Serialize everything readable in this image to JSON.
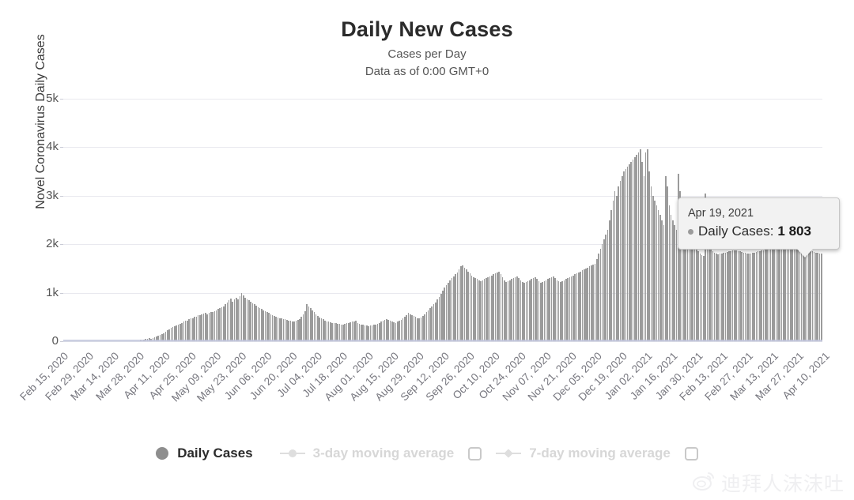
{
  "header": {
    "title": "Daily New Cases",
    "subtitle": "Cases per Day",
    "subtitle2": "Data as of 0:00 GMT+0"
  },
  "y_axis": {
    "title": "Novel Coronavirus Daily Cases",
    "ticks": [
      "5k",
      "4k",
      "3k",
      "2k",
      "1k",
      "0"
    ]
  },
  "tooltip": {
    "date": "Apr 19, 2021",
    "series_label": "Daily Cases:",
    "value": "1 803",
    "dot_color": "#9b9b9b"
  },
  "legend": {
    "items": [
      {
        "label": "Daily Cases",
        "marker": "filled-circle",
        "state": "active",
        "checkbox": false
      },
      {
        "label": "3-day moving average",
        "marker": "line-circle",
        "state": "muted",
        "checkbox": true
      },
      {
        "label": "7-day moving average",
        "marker": "line-diamond",
        "state": "muted",
        "checkbox": true
      }
    ]
  },
  "watermark": {
    "text": "迪拜人沫沫吐",
    "icon": "weibo-icon"
  },
  "colors": {
    "bar": "#9b9b9b",
    "grid": "#e9e9ef",
    "zero_line": "#d8dae6",
    "moving_average_line": "#c3c7dd",
    "tick_text": "#555555",
    "xlabel_text": "#76767e"
  },
  "chart_data": {
    "type": "bar",
    "title": "Daily New Cases",
    "subtitle": "Cases per Day",
    "xlabel": "",
    "ylabel": "Novel Coronavirus Daily Cases",
    "ylim": [
      0,
      5000
    ],
    "yticks": [
      0,
      1000,
      2000,
      3000,
      4000,
      5000
    ],
    "grid": true,
    "legend_position": "bottom",
    "x_tick_labels": [
      "Feb 15, 2020",
      "Feb 29, 2020",
      "Mar 14, 2020",
      "Mar 28, 2020",
      "Apr 11, 2020",
      "Apr 25, 2020",
      "May 09, 2020",
      "May 23, 2020",
      "Jun 06, 2020",
      "Jun 20, 2020",
      "Jul 04, 2020",
      "Jul 18, 2020",
      "Aug 01, 2020",
      "Aug 15, 2020",
      "Aug 29, 2020",
      "Sep 12, 2020",
      "Sep 26, 2020",
      "Oct 10, 2020",
      "Oct 24, 2020",
      "Nov 07, 2020",
      "Nov 21, 2020",
      "Dec 05, 2020",
      "Dec 19, 2020",
      "Jan 02, 2021",
      "Jan 16, 2021",
      "Jan 30, 2021",
      "Feb 13, 2021",
      "Feb 27, 2021",
      "Mar 13, 2021",
      "Mar 27, 2021",
      "Apr 10, 2021"
    ],
    "x_tick_interval_days": 14,
    "start_date": "Feb 15, 2020",
    "end_date": "Apr 19, 2021",
    "highlighted_point": {
      "x": "Apr 19, 2021",
      "y": 1803
    },
    "series": [
      {
        "name": "Daily Cases",
        "values": [
          0,
          0,
          0,
          0,
          0,
          0,
          0,
          0,
          0,
          0,
          0,
          0,
          0,
          0,
          0,
          0,
          0,
          0,
          0,
          0,
          0,
          0,
          0,
          0,
          0,
          0,
          0,
          0,
          0,
          0,
          0,
          0,
          0,
          0,
          0,
          0,
          0,
          0,
          0,
          0,
          0,
          0,
          30,
          35,
          40,
          45,
          50,
          60,
          55,
          70,
          80,
          90,
          110,
          130,
          150,
          170,
          200,
          230,
          250,
          270,
          290,
          310,
          330,
          350,
          360,
          380,
          400,
          420,
          430,
          450,
          470,
          480,
          500,
          510,
          530,
          540,
          560,
          570,
          580,
          560,
          590,
          600,
          610,
          620,
          640,
          660,
          680,
          700,
          720,
          760,
          800,
          850,
          880,
          820,
          860,
          900,
          870,
          930,
          990,
          950,
          900,
          870,
          840,
          810,
          790,
          760,
          730,
          700,
          680,
          660,
          640,
          620,
          600,
          580,
          560,
          540,
          520,
          500,
          490,
          480,
          470,
          460,
          450,
          440,
          430,
          420,
          410,
          400,
          420,
          440,
          460,
          500,
          560,
          620,
          760,
          720,
          680,
          640,
          600,
          560,
          520,
          490,
          470,
          450,
          430,
          410,
          400,
          390,
          380,
          370,
          370,
          360,
          360,
          350,
          350,
          360,
          370,
          380,
          390,
          400,
          410,
          420,
          380,
          360,
          350,
          340,
          330,
          320,
          310,
          320,
          330,
          340,
          350,
          360,
          380,
          400,
          420,
          440,
          460,
          440,
          420,
          400,
          390,
          380,
          400,
          420,
          440,
          470,
          500,
          540,
          580,
          560,
          540,
          520,
          500,
          480,
          470,
          490,
          520,
          560,
          600,
          640,
          680,
          720,
          760,
          800,
          860,
          920,
          980,
          1040,
          1100,
          1150,
          1200,
          1250,
          1300,
          1340,
          1380,
          1420,
          1480,
          1540,
          1560,
          1520,
          1480,
          1440,
          1400,
          1360,
          1320,
          1300,
          1280,
          1260,
          1240,
          1260,
          1280,
          1300,
          1320,
          1340,
          1360,
          1380,
          1400,
          1420,
          1440,
          1380,
          1320,
          1260,
          1220,
          1240,
          1260,
          1280,
          1300,
          1320,
          1340,
          1300,
          1260,
          1220,
          1200,
          1220,
          1240,
          1260,
          1280,
          1300,
          1320,
          1280,
          1240,
          1200,
          1220,
          1240,
          1260,
          1280,
          1300,
          1320,
          1340,
          1300,
          1260,
          1240,
          1220,
          1240,
          1260,
          1280,
          1300,
          1320,
          1340,
          1360,
          1380,
          1400,
          1420,
          1440,
          1460,
          1480,
          1500,
          1520,
          1540,
          1560,
          1580,
          1600,
          1700,
          1800,
          1900,
          2000,
          2100,
          2200,
          2300,
          2500,
          2700,
          2900,
          3100,
          3000,
          3200,
          3300,
          3400,
          3500,
          3550,
          3600,
          3650,
          3700,
          3750,
          3800,
          3850,
          3900,
          3950,
          3700,
          3400,
          3900,
          3950,
          3500,
          3200,
          3000,
          2900,
          2800,
          2700,
          2600,
          2500,
          2400,
          3400,
          3200,
          2800,
          2600,
          2500,
          2400,
          2300,
          3450,
          3100,
          2700,
          2500,
          2400,
          2300,
          2200,
          2100,
          2000,
          1950,
          1900,
          1850,
          1800,
          1780,
          1760,
          3050,
          2400,
          2000,
          1900,
          1850,
          1820,
          1800,
          1790,
          1800,
          1810,
          1820,
          1830,
          1840,
          1850,
          1860,
          1870,
          1880,
          1870,
          1860,
          1850,
          1840,
          1830,
          1820,
          1810,
          1800,
          1810,
          1820,
          1830,
          1840,
          1850,
          1860,
          1870,
          1880,
          1890,
          1900,
          1910,
          1920,
          1930,
          1940,
          1950,
          1960,
          1970,
          1980,
          1990,
          2000,
          1990,
          1980,
          1970,
          1960,
          1950,
          1940,
          1930,
          1920,
          1910,
          1900,
          1890,
          1880,
          1870,
          1860,
          1850,
          1840,
          1830,
          1820,
          1810,
          1803
        ]
      }
    ]
  }
}
